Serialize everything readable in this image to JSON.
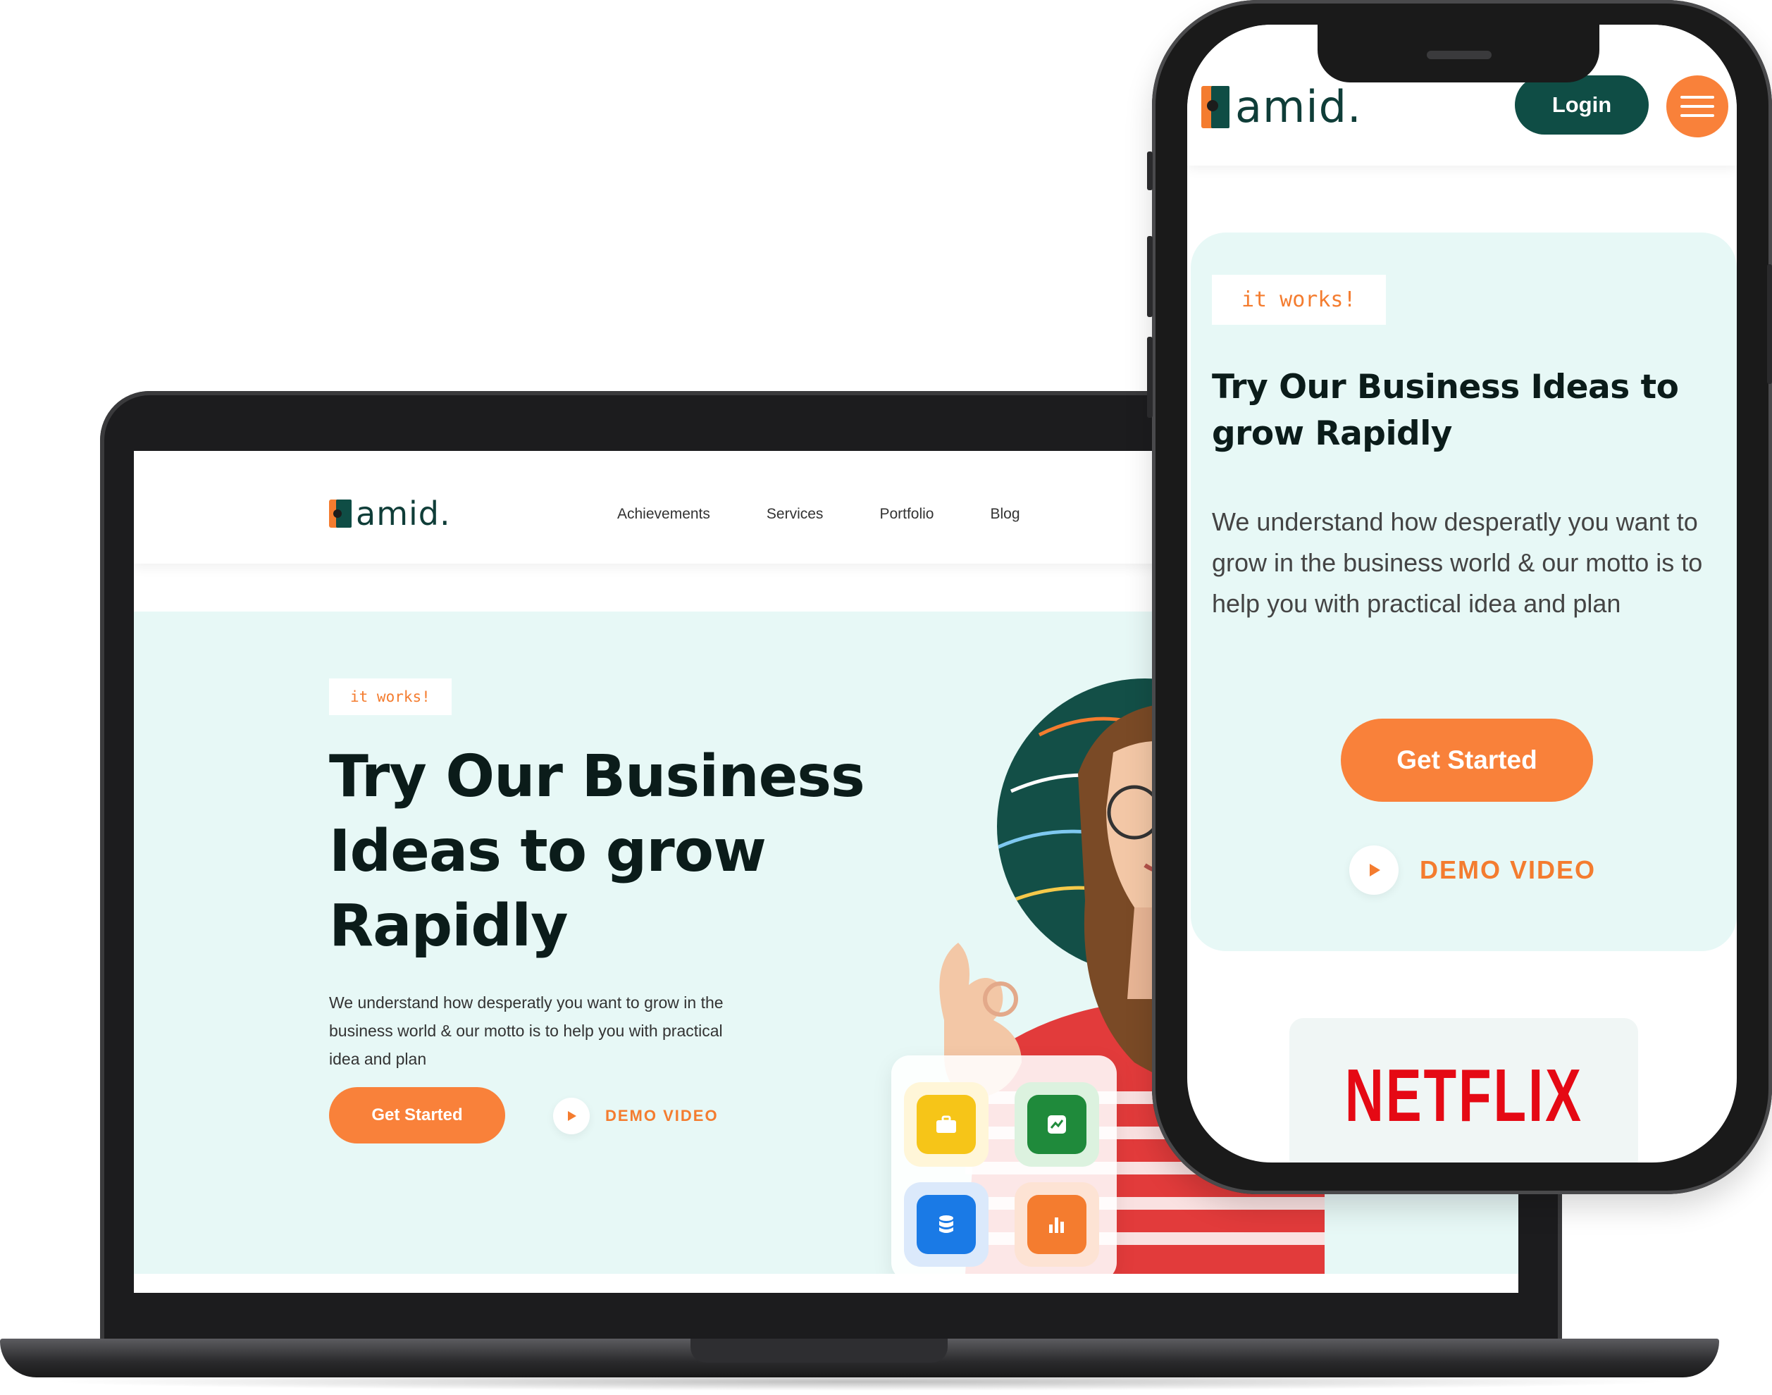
{
  "brand": {
    "name": "amid.",
    "primary_color": "#0f4d45",
    "accent_color": "#f47c2f"
  },
  "laptop": {
    "nav": [
      "Achievements",
      "Services",
      "Portfolio",
      "Blog"
    ],
    "hero": {
      "badge": "it works!",
      "title": "Try Our Business Ideas to grow Rapidly",
      "description": "We understand how desperatly you want to grow in the business world & our motto is to help you with practical idea and plan",
      "cta_label": "Get Started",
      "demo_label": "DEMO VIDEO"
    },
    "feature_icons": [
      "briefcase-icon",
      "chart-line-icon",
      "database-icon",
      "bar-chart-icon"
    ]
  },
  "phone": {
    "login_label": "Login",
    "menu_icon": "hamburger-menu-icon",
    "hero": {
      "badge": "it works!",
      "title": "Try Our Business Ideas to grow Rapidly",
      "description": "We understand how desperatly you want to grow in the business world & our motto is to help you with practical idea and plan",
      "cta_label": "Get Started",
      "demo_label": "DEMO VIDEO"
    },
    "brand_logo_text": "NETFLIX"
  }
}
